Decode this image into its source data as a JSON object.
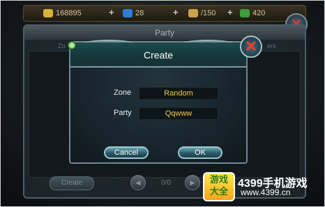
{
  "resources": {
    "gold": "168895",
    "gems": "28",
    "energy": "/150",
    "other": "420",
    "colors": {
      "gold": "#d9b23a",
      "gem": "#2e7dd8",
      "energy": "#c9a24a",
      "other": "#3f9c3a"
    }
  },
  "background_window": {
    "title": "Party",
    "col_left": "Zo",
    "col_right": "ers",
    "create_label": "Create",
    "page_indicator": "0/0"
  },
  "dialog": {
    "title": "Create",
    "zone_label": "Zone",
    "zone_value": "Random",
    "party_label": "Party",
    "party_value": "Qqwww",
    "cancel_label": "Cancel",
    "ok_label": "OK",
    "close_icon": "close-icon",
    "accent_value_color": "#f2c94c"
  },
  "watermark": {
    "badge_line1": "游戏",
    "badge_line2": "大全",
    "brand": "4399手机游戏",
    "url": "www.4399.cn"
  }
}
